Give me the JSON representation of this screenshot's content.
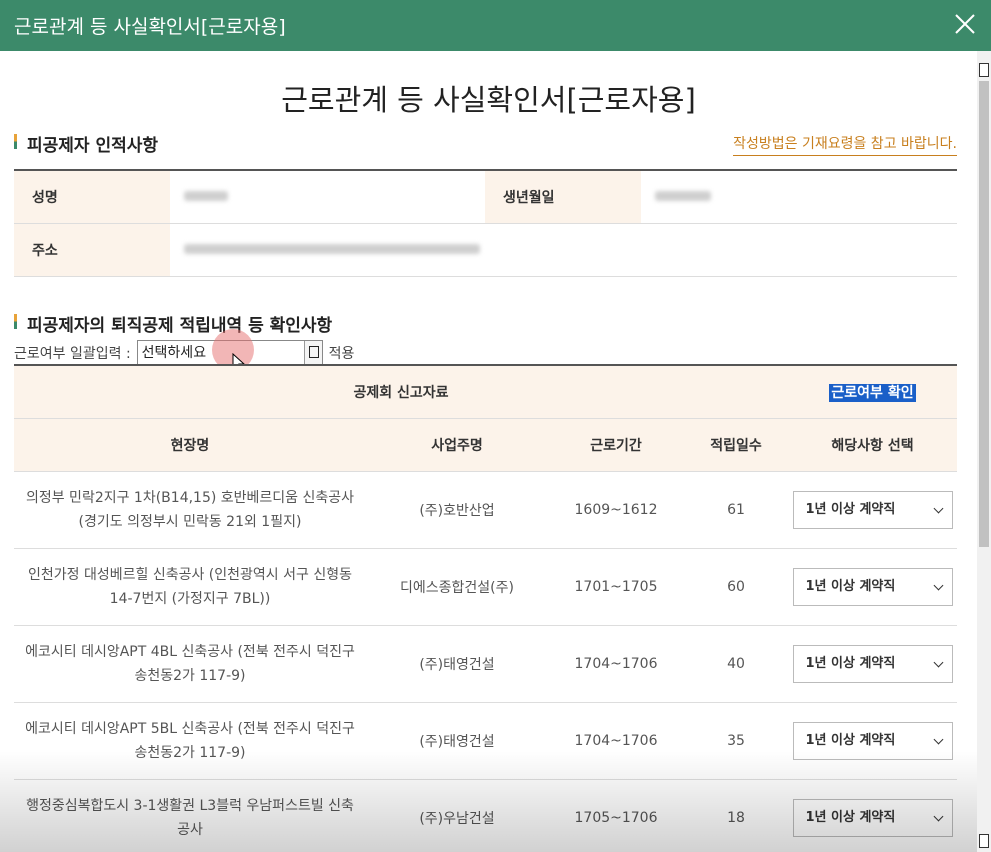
{
  "window": {
    "title": "근로관계 등 사실확인서[근로자용]"
  },
  "document": {
    "title": "근로관계 등 사실확인서[근로자용]",
    "guide_link": "작성방법은 기재요령을 참고 바랍니다."
  },
  "section1": {
    "title": "피공제자 인적사항",
    "name_label": "성명",
    "birth_label": "생년월일",
    "address_label": "주소"
  },
  "section2": {
    "title": "피공제자의 퇴직공제 적립내역 등 확인사항",
    "bulk_label": "근로여부 일괄입력 :",
    "bulk_value": "선택하세요",
    "apply_label": "적용"
  },
  "table": {
    "group_header_left": "공제회 신고자료",
    "group_header_right": "근로여부 확인",
    "columns": [
      "현장명",
      "사업주명",
      "근로기간",
      "적립일수",
      "해당사항 선택"
    ],
    "rows": [
      {
        "site": "의정부 민락2지구 1차(B14,15) 호반베르디움 신축공사 (경기도 의정부시 민락동 21외 1필지)",
        "employer": "(주)호반산업",
        "period": "1609~1612",
        "days": "61",
        "selection": "1년 이상 계약직"
      },
      {
        "site": "인천가정 대성베르힐 신축공사 (인천광역시 서구 신형동 14-7번지 (가정지구 7BL))",
        "employer": "디에스종합건설(주)",
        "period": "1701~1705",
        "days": "60",
        "selection": "1년 이상 계약직"
      },
      {
        "site": "에코시티 데시앙APT 4BL 신축공사 (전북 전주시 덕진구 송천동2가 117-9)",
        "employer": "(주)태영건설",
        "period": "1704~1706",
        "days": "40",
        "selection": "1년 이상 계약직"
      },
      {
        "site": "에코시티 데시앙APT 5BL 신축공사 (전북 전주시 덕진구 송천동2가 117-9)",
        "employer": "(주)태영건설",
        "period": "1704~1706",
        "days": "35",
        "selection": "1년 이상 계약직"
      },
      {
        "site": "행정중심복합도시 3-1생활권 L3블럭 우남퍼스트빌 신축공사",
        "employer": "(주)우남건설",
        "period": "1705~1706",
        "days": "18",
        "selection": "1년 이상 계약직"
      }
    ]
  },
  "colors": {
    "header_green": "#3c8a6a",
    "accent_orange": "#c87f1e",
    "table_header_bg": "#fcf3ea",
    "highlight_blue": "#1a5fc8"
  }
}
